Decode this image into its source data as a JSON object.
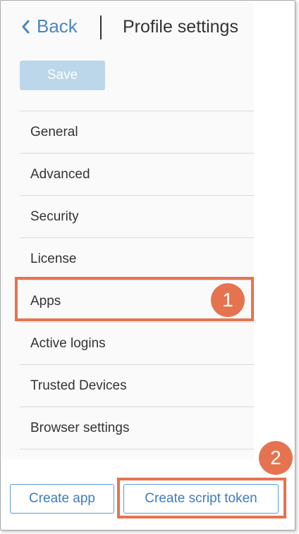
{
  "header": {
    "back_label": "Back",
    "title": "Profile settings",
    "back_icon": "chevron-left-icon"
  },
  "toolbar": {
    "save_label": "Save"
  },
  "nav": {
    "items": [
      {
        "label": "General"
      },
      {
        "label": "Advanced"
      },
      {
        "label": "Security"
      },
      {
        "label": "License"
      },
      {
        "label": "Apps"
      },
      {
        "label": "Active logins"
      },
      {
        "label": "Trusted Devices"
      },
      {
        "label": "Browser settings"
      }
    ]
  },
  "callouts": {
    "step1": "1",
    "step2": "2"
  },
  "footer": {
    "create_app_label": "Create app",
    "create_token_label": "Create script token"
  },
  "colors": {
    "accent": "#4a86c5",
    "highlight": "#e5734f",
    "save_disabled": "#bcd6ea",
    "panel_bg": "#fafafa"
  }
}
